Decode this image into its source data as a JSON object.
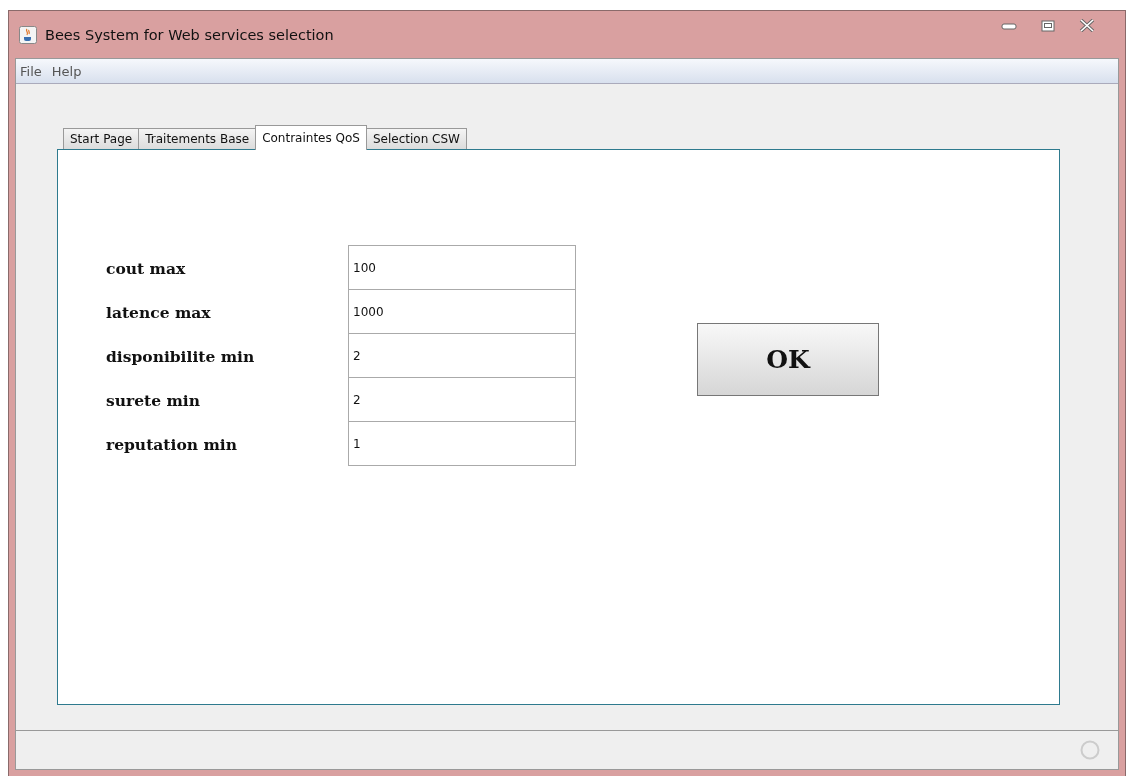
{
  "window": {
    "title": "Bees System for Web services selection"
  },
  "menu": [
    "File",
    "Help"
  ],
  "tabs": [
    {
      "label": "Start Page",
      "selected": false
    },
    {
      "label": "Traitements Base",
      "selected": false
    },
    {
      "label": "Contraintes QoS",
      "selected": true
    },
    {
      "label": "Selection CSW",
      "selected": false
    }
  ],
  "fields": [
    {
      "label": "cout max",
      "value": "100"
    },
    {
      "label": "latence max",
      "value": "1000"
    },
    {
      "label": "disponibilite min",
      "value": "2"
    },
    {
      "label": "surete min",
      "value": "2"
    },
    {
      "label": "reputation min",
      "value": "1"
    }
  ],
  "ok_button": "OK"
}
